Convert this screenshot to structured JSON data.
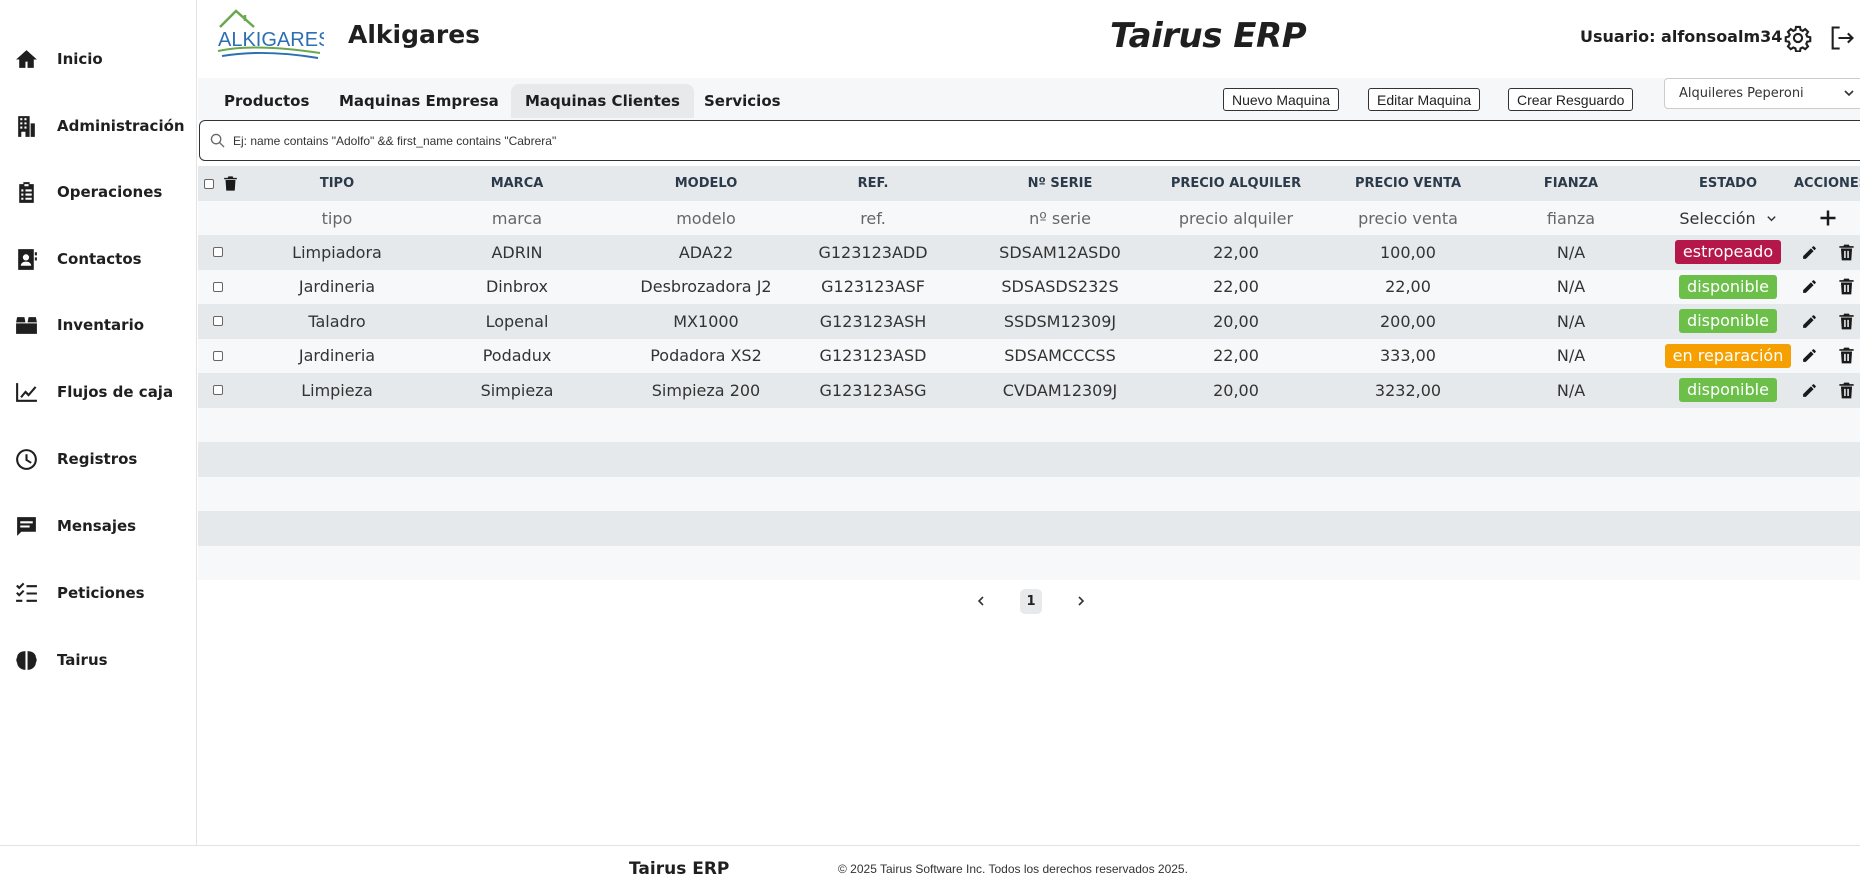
{
  "sidebar": {
    "items": [
      {
        "label": "Inicio",
        "icon": "home-icon"
      },
      {
        "label": "Administración",
        "icon": "building-icon"
      },
      {
        "label": "Operaciones",
        "icon": "clipboard-icon"
      },
      {
        "label": "Contactos",
        "icon": "contact-book-icon"
      },
      {
        "label": "Inventario",
        "icon": "box-icon"
      },
      {
        "label": "Flujos de caja",
        "icon": "chart-line-icon"
      },
      {
        "label": "Registros",
        "icon": "clock-icon"
      },
      {
        "label": "Mensajes",
        "icon": "message-icon"
      },
      {
        "label": "Peticiones",
        "icon": "checklist-icon"
      },
      {
        "label": "Tairus",
        "icon": "brain-icon"
      }
    ]
  },
  "header": {
    "logo_text": "ALKIGARES",
    "company_name": "Alkigares",
    "app_title": "Tairus ERP",
    "user_label": "Usuario: alfonsoalm34"
  },
  "tabs": [
    {
      "label": "Productos",
      "active": false
    },
    {
      "label": "Maquinas Empresa",
      "active": false
    },
    {
      "label": "Maquinas Clientes",
      "active": true
    },
    {
      "label": "Servicios",
      "active": false
    }
  ],
  "actions": {
    "new_label": "Nuevo Maquina",
    "edit_label": "Editar Maquina",
    "guard_label": "Crear Resguardo",
    "company_select": "Alquileres Peperoni"
  },
  "search": {
    "placeholder": "Ej: name contains \"Adolfo\" && first_name contains \"Cabrera\""
  },
  "table": {
    "columns": [
      "TIPO",
      "MARCA",
      "MODELO",
      "REF.",
      "Nº SERIE",
      "PRECIO ALQUILER",
      "PRECIO VENTA",
      "FIANZA",
      "ESTADO",
      "ACCIONES"
    ],
    "filters": [
      "tipo",
      "marca",
      "modelo",
      "ref.",
      "nº serie",
      "precio alquiler",
      "precio venta",
      "fianza"
    ],
    "estado_filter": "Selección",
    "rows": [
      {
        "tipo": "Limpiadora",
        "marca": "ADRIN",
        "modelo": "ADA22",
        "ref": "G123123ADD",
        "serie": "SDSAM12ASD0",
        "alquiler": "22,00",
        "venta": "100,00",
        "fianza": "N/A",
        "estado": "estropeado",
        "estado_color": "#b5174b"
      },
      {
        "tipo": "Jardineria",
        "marca": "Dinbrox",
        "modelo": "Desbrozadora J2",
        "ref": "G123123ASF",
        "serie": "SDSASDS232S",
        "alquiler": "22,00",
        "venta": "22,00",
        "fianza": "N/A",
        "estado": "disponible",
        "estado_color": "#6cc04a"
      },
      {
        "tipo": "Taladro",
        "marca": "Lopenal",
        "modelo": "MX1000",
        "ref": "G123123ASH",
        "serie": "SSDSM12309J",
        "alquiler": "20,00",
        "venta": "200,00",
        "fianza": "N/A",
        "estado": "disponible",
        "estado_color": "#6cc04a"
      },
      {
        "tipo": "Jardineria",
        "marca": "Podadux",
        "modelo": "Podadora XS2",
        "ref": "G123123ASD",
        "serie": "SDSAMCCCSS",
        "alquiler": "22,00",
        "venta": "333,00",
        "fianza": "N/A",
        "estado": "en reparación",
        "estado_color": "#f5a000"
      },
      {
        "tipo": "Limpieza",
        "marca": "Simpieza",
        "modelo": "Simpieza 200",
        "ref": "G123123ASG",
        "serie": "CVDAM12309J",
        "alquiler": "20,00",
        "venta": "3232,00",
        "fianza": "N/A",
        "estado": "disponible",
        "estado_color": "#6cc04a"
      }
    ]
  },
  "pagination": {
    "current": "1"
  },
  "footer": {
    "brand": "Tairus ERP",
    "copyright": "© 2025 Tairus Software Inc. Todos los derechos reservados 2025."
  },
  "colors": {
    "row_even": "#e6e9ec",
    "row_odd": "#f7f8f9",
    "logo_green": "#6aa84f",
    "logo_blue": "#2d6fb3"
  }
}
